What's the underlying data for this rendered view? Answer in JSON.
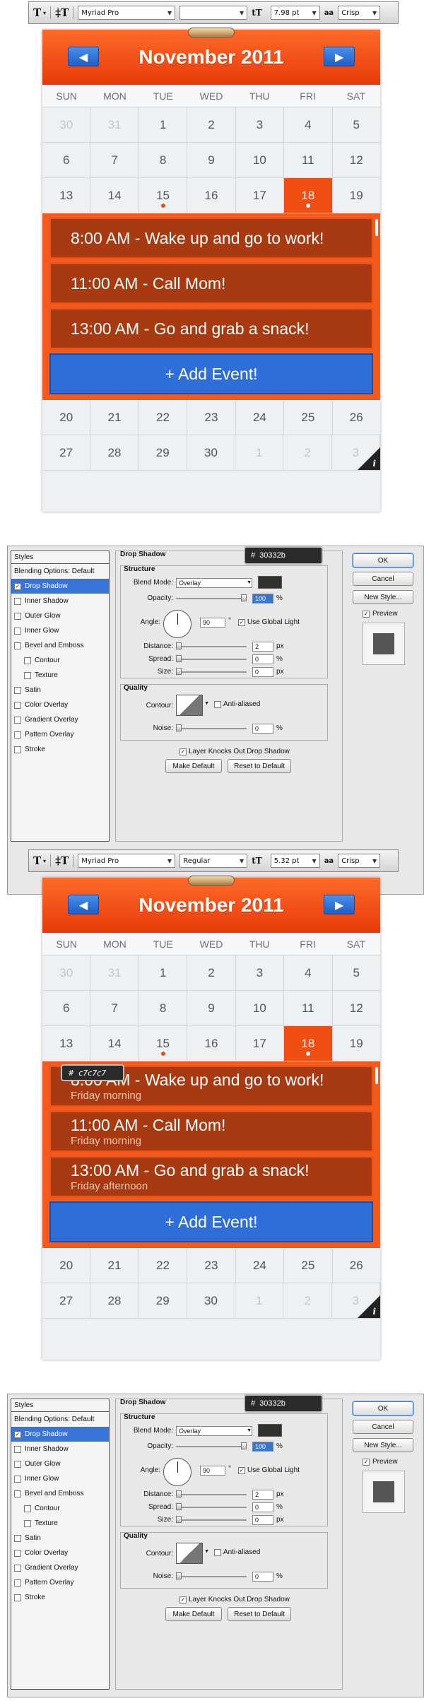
{
  "toolbar1": {
    "font_family": "Myriad Pro",
    "font_style": "",
    "font_size": "7.98 pt",
    "aa_label": "aa",
    "aa_mode": "Crisp"
  },
  "toolbar2": {
    "font_family": "Myriad Pro",
    "font_style": "Regular",
    "font_size": "5.32 pt",
    "aa_label": "aa",
    "aa_mode": "Crisp"
  },
  "calendar": {
    "title": "November 2011",
    "days": [
      "SUN",
      "MON",
      "TUE",
      "WED",
      "THU",
      "FRI",
      "SAT"
    ],
    "weeks_top": [
      [
        "30",
        "31",
        "1",
        "2",
        "3",
        "4",
        "5"
      ],
      [
        "6",
        "7",
        "8",
        "9",
        "10",
        "11",
        "12"
      ],
      [
        "13",
        "14",
        "15",
        "16",
        "17",
        "18",
        "19"
      ]
    ],
    "weeks_bottom": [
      [
        "20",
        "21",
        "22",
        "23",
        "24",
        "25",
        "26"
      ],
      [
        "27",
        "28",
        "29",
        "30",
        "1",
        "2",
        "3"
      ]
    ],
    "add_event": "+ Add Event!",
    "info_glyph": "i"
  },
  "events1": [
    {
      "title": "8:00 AM - Wake up and go to work!"
    },
    {
      "title": "11:00 AM - Call Mom!"
    },
    {
      "title": "13:00 AM - Go  and grab a snack!"
    }
  ],
  "events2": [
    {
      "title": "8:00 AM - Wake up and go to work!",
      "sub": "Friday morning"
    },
    {
      "title": "11:00 AM - Call Mom!",
      "sub": "Friday morning"
    },
    {
      "title": "13:00 AM - Go  and grab a snack!",
      "sub": "Friday afternoon"
    }
  ],
  "tip_c7": {
    "hash": "#",
    "value": "c7c7c7"
  },
  "dialog": {
    "styles_header": "Styles",
    "styles": [
      "Blending Options: Default",
      "Drop Shadow",
      "Inner Shadow",
      "Outer Glow",
      "Inner Glow",
      "Bevel and Emboss",
      "Contour",
      "Texture",
      "Satin",
      "Color Overlay",
      "Gradient Overlay",
      "Pattern Overlay",
      "Stroke"
    ],
    "section": "Drop Shadow",
    "structure": "Structure",
    "quality": "Quality",
    "blend_mode_label": "Blend Mode:",
    "blend_mode": "Overlay",
    "opacity_label": "Opacity:",
    "opacity": "100",
    "pct": "%",
    "angle_label": "Angle:",
    "angle": "90",
    "deg": "°",
    "global_light": "Use Global Light",
    "distance_label": "Distance:",
    "distance": "2",
    "px": "px",
    "spread_label": "Spread:",
    "spread": "0",
    "size_label": "Size:",
    "size": "0",
    "contour_label": "Contour:",
    "anti_aliased": "Anti-aliased",
    "noise_label": "Noise:",
    "noise": "0",
    "knocks_out": "Layer Knocks Out Drop Shadow",
    "make_default": "Make Default",
    "reset_default": "Reset to Default",
    "ok": "OK",
    "cancel": "Cancel",
    "new_style": "New Style...",
    "preview": "Preview",
    "tip_hash": "#",
    "tip_value": "30332b",
    "colors": {
      "shadow": "#30332b"
    }
  }
}
